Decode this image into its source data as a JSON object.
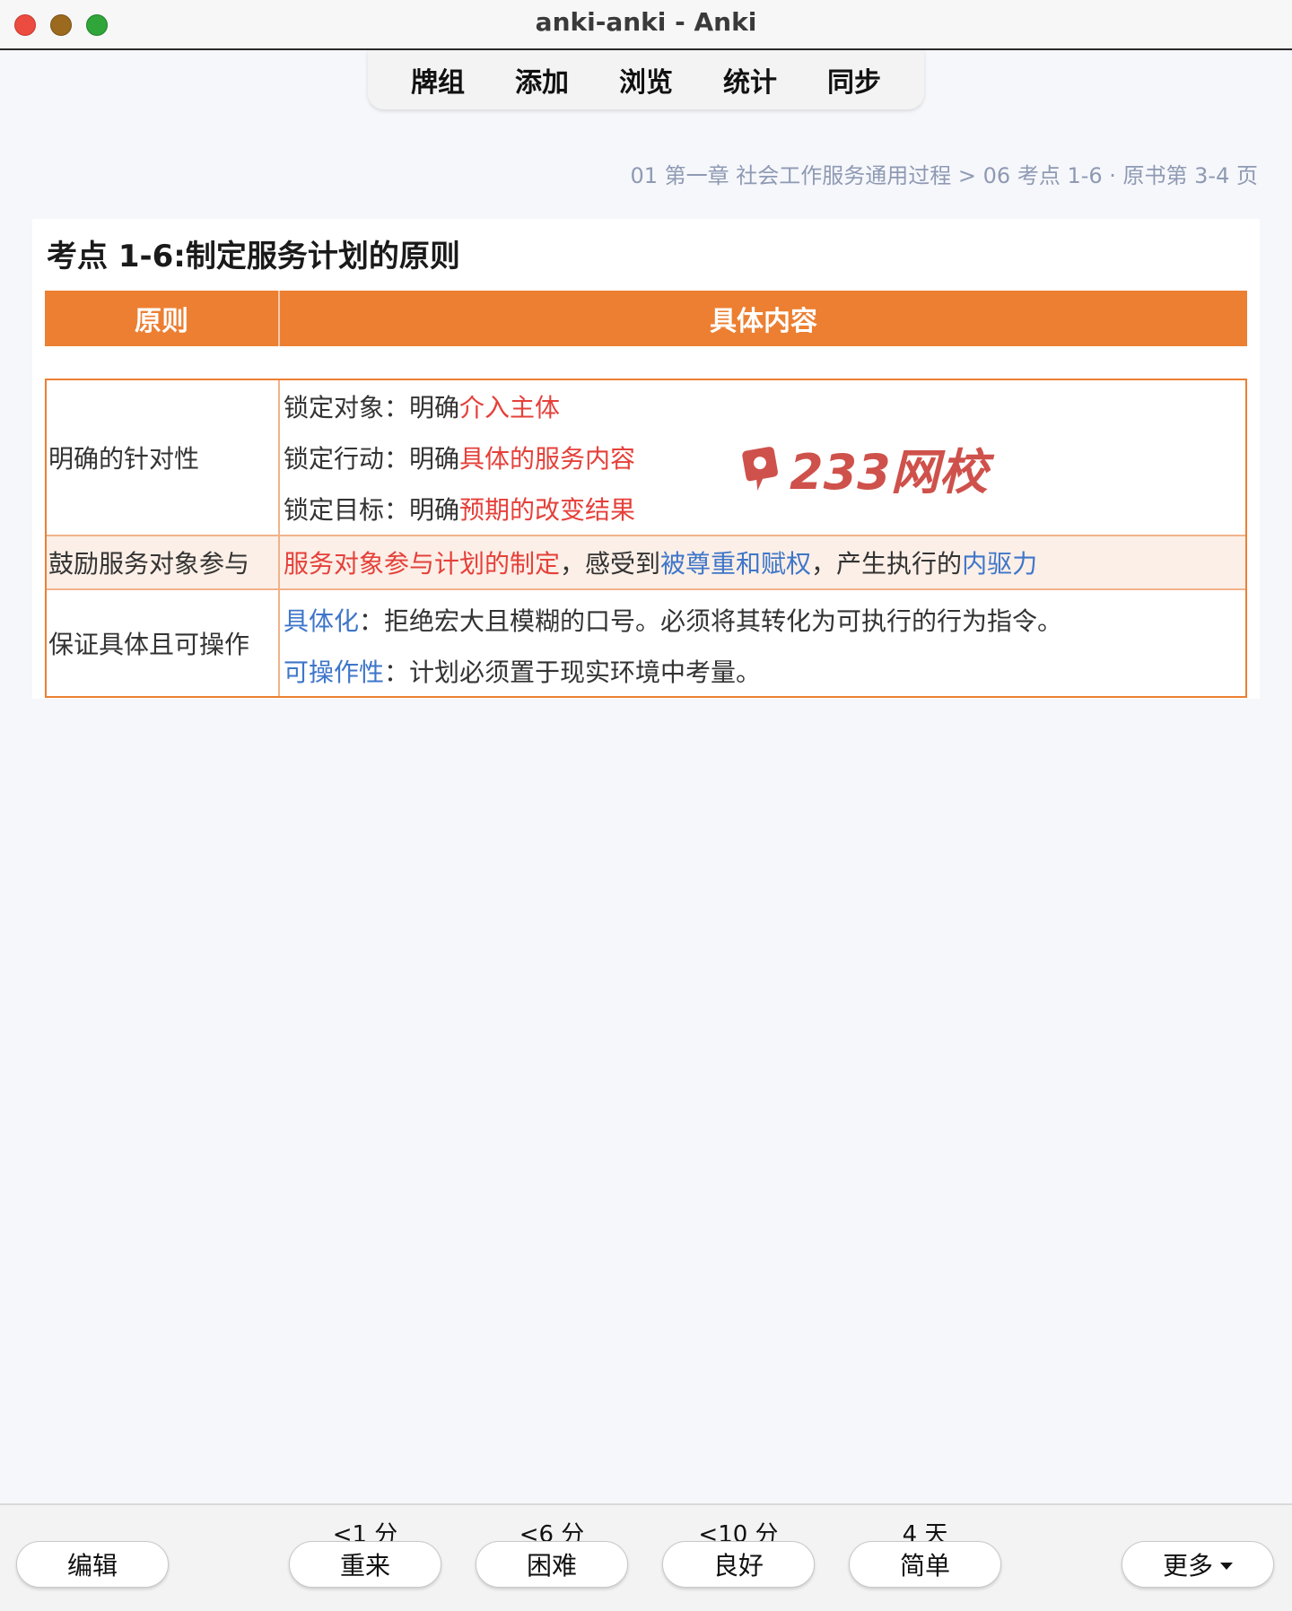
{
  "window": {
    "title": "anki-anki - Anki"
  },
  "toolbar": {
    "items": [
      "牌组",
      "添加",
      "浏览",
      "统计",
      "同步"
    ]
  },
  "breadcrumb": "01 第一章 社会工作服务通用过程 > 06 考点 1-6 · 原书第 3-4 页",
  "card": {
    "title": "考点 1-6:制定服务计划的原则",
    "headers": [
      "原则",
      "具体内容"
    ],
    "rows": [
      {
        "principle": "明确的针对性",
        "lines": [
          {
            "prefix": "锁定对象：明确",
            "highlight": "介入主体"
          },
          {
            "prefix": "锁定行动：明确",
            "highlight": "具体的服务内容"
          },
          {
            "prefix": "锁定目标：明确",
            "highlight": "预期的改变结果"
          }
        ]
      },
      {
        "principle": "鼓励服务对象参与",
        "segments": {
          "s1": "服务对象参与计划的制定",
          "s2": "，感受到",
          "s3": "被尊重和赋权",
          "s4": "，产生执行的",
          "s5": "内驱力"
        }
      },
      {
        "principle": "保证具体且可操作",
        "lines": [
          {
            "term": "具体化",
            "text": "：拒绝宏大且模糊的口号。必须将其转化为可执行的行为指令。"
          },
          {
            "term": "可操作性",
            "text": "：计划必须置于现实环境中考量。"
          }
        ]
      }
    ],
    "watermark": "233网校"
  },
  "answer_bar": {
    "edit_label": "编辑",
    "more_label": "更多",
    "buttons": [
      {
        "timing": "<1 分",
        "label": "重来"
      },
      {
        "timing": "<6 分",
        "label": "困难"
      },
      {
        "timing": "<10 分",
        "label": "良好"
      },
      {
        "timing": "4 天",
        "label": "简单"
      }
    ]
  },
  "colors": {
    "header_orange": "#ec7f32",
    "highlight_red": "#e5403a",
    "highlight_blue": "#3e76c9",
    "breadcrumb_gray": "#8e9ab3"
  }
}
